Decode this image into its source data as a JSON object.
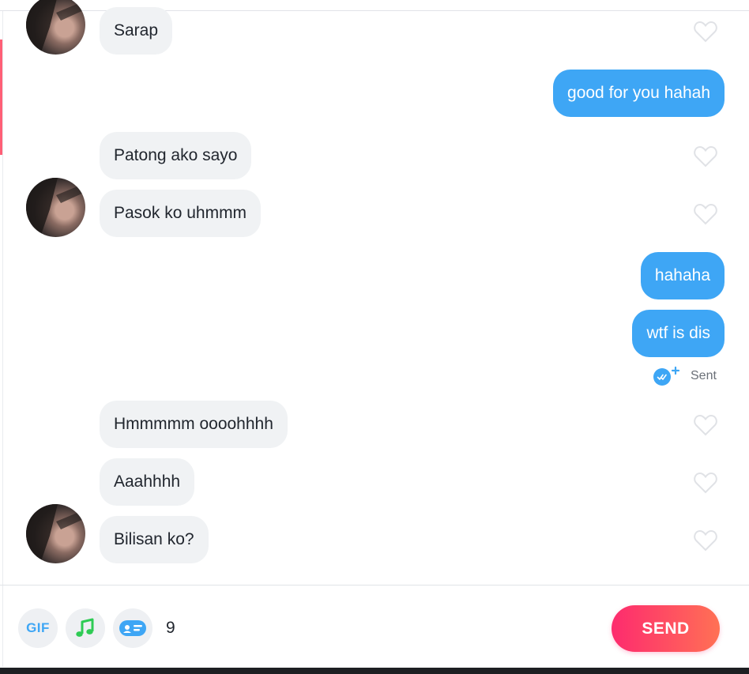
{
  "conversation": {
    "messages": [
      {
        "sender": "match",
        "text": "Sarap"
      },
      {
        "sender": "me",
        "text": "good for you hahah"
      },
      {
        "sender": "match",
        "text": "Patong ako sayo"
      },
      {
        "sender": "match",
        "text": "Pasok ko uhmmm"
      },
      {
        "sender": "me",
        "text": "hahaha"
      },
      {
        "sender": "me",
        "text": "wtf is dis"
      },
      {
        "sender": "match",
        "text": "Hmmmmm oooohhhh"
      },
      {
        "sender": "match",
        "text": "Aaahhhh"
      },
      {
        "sender": "match",
        "text": "Bilisan ko?"
      }
    ],
    "status": "Sent"
  },
  "composer": {
    "gif_label": "GIF",
    "char_count": "9",
    "send_label": "SEND"
  },
  "colors": {
    "outgoing_bubble": "#3ea6f5",
    "incoming_bubble": "#f0f2f4",
    "send_gradient_start": "#fd2b6e",
    "send_gradient_end": "#ff7154",
    "music_icon": "#2ecb54"
  },
  "icons": [
    "heart-icon",
    "read-receipt-icon",
    "music-note-icon",
    "sticker-icon"
  ]
}
